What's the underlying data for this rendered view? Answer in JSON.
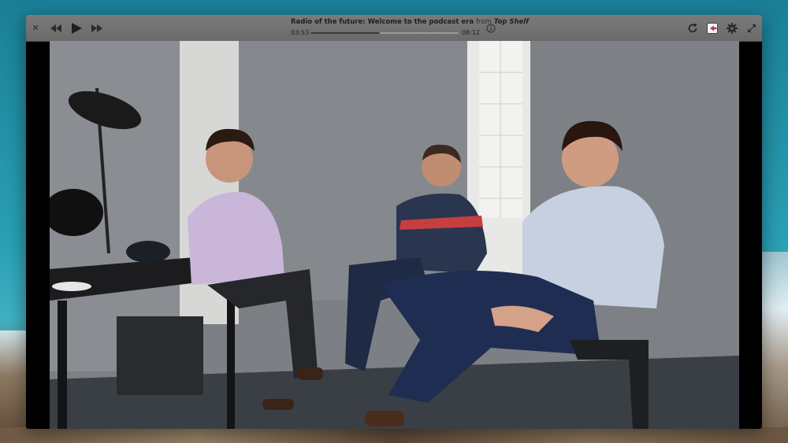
{
  "player": {
    "episode_title": "Radio of the future: Welcome to the podcast era",
    "from_label": "from",
    "show_name": "Top Shelf",
    "elapsed": "03:53",
    "total": "08:12",
    "progress_fraction": 0.47
  },
  "icons": {
    "close": "close-icon",
    "prev": "rewind-icon",
    "play": "play-icon",
    "next": "fast-forward-icon",
    "info": "info-icon",
    "reload": "reload-icon",
    "share": "share-icon",
    "settings": "gear-icon",
    "expand": "expand-icon"
  },
  "colors": {
    "titlebar": "#707070",
    "desktop_teal": "#2aa0b5",
    "share_accent": "#c0287a"
  }
}
